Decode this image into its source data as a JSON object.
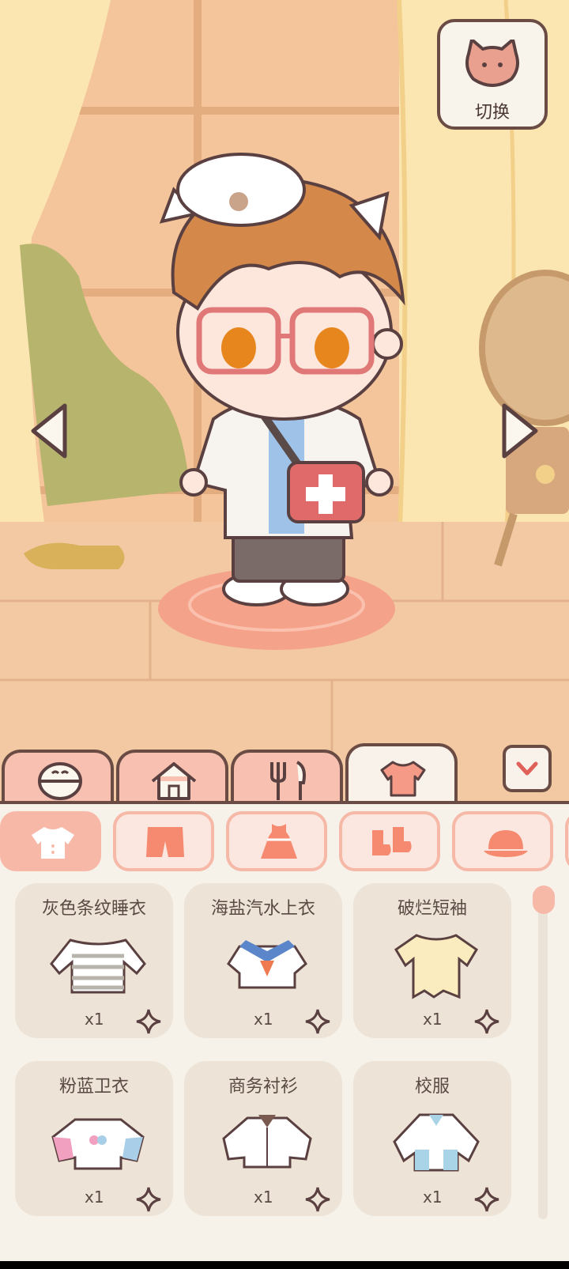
{
  "switch_button": {
    "label": "切换",
    "icon": "cat-face-icon"
  },
  "tabs": [
    {
      "icon": "face-icon"
    },
    {
      "icon": "house-icon"
    },
    {
      "icon": "fork-knife-icon"
    },
    {
      "icon": "shirt-icon",
      "active": true
    }
  ],
  "subcategories": [
    {
      "icon": "top-icon",
      "active": true
    },
    {
      "icon": "shorts-icon"
    },
    {
      "icon": "dress-icon"
    },
    {
      "icon": "shoes-icon"
    },
    {
      "icon": "hat-icon"
    }
  ],
  "items": [
    {
      "name": "灰色条纹睡衣",
      "qty": "x1",
      "icon": "striped-pajama-icon"
    },
    {
      "name": "海盐汽水上衣",
      "qty": "x1",
      "icon": "sailor-top-icon"
    },
    {
      "name": "破烂短袖",
      "qty": "x1",
      "icon": "torn-tshirt-icon"
    },
    {
      "name": "粉蓝卫衣",
      "qty": "x1",
      "icon": "pink-blue-hoodie-icon"
    },
    {
      "name": "商务衬衫",
      "qty": "x1",
      "icon": "business-shirt-icon"
    },
    {
      "name": "校服",
      "qty": "x1",
      "icon": "school-uniform-icon"
    }
  ],
  "colors": {
    "outline": "#6b4c45",
    "tab_pink": "#f7c0b0",
    "accent": "#f6b8a7",
    "card_bg": "#ede3d6",
    "panel_bg": "#f6f2ea",
    "favorite_icon": "sparkle-icon"
  }
}
